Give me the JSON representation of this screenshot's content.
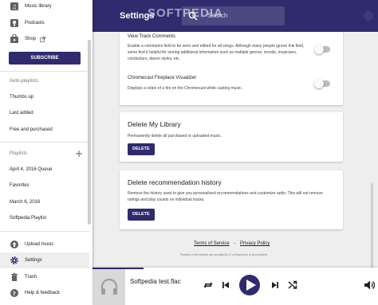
{
  "topbar": {
    "title": "Settings",
    "search_placeholder": "Search",
    "watermark": "SOFTPEDIA"
  },
  "sidebar": {
    "items_top": [
      {
        "label": "Music library",
        "icon": "music-library-icon"
      },
      {
        "label": "Podcasts",
        "icon": "podcast-icon"
      },
      {
        "label": "Shop",
        "icon": "shop-icon"
      }
    ],
    "subscribe_label": "SUBSCRIBE",
    "auto_playlists_header": "Auto-playlists",
    "auto_playlists": [
      "Thumbs up",
      "Last added",
      "Free and purchased"
    ],
    "playlists_header": "Playlists",
    "playlists": [
      "April 4, 2016 Queue",
      "Favorites",
      "March 6, 2016",
      "Softpedia Playlist"
    ],
    "items_bottom": [
      {
        "label": "Upload music",
        "icon": "upload-icon"
      },
      {
        "label": "Settings",
        "icon": "gear-icon"
      },
      {
        "label": "Trash",
        "icon": "trash-icon"
      },
      {
        "label": "Help & feedback",
        "icon": "help-icon"
      }
    ]
  },
  "settings": {
    "track_comments": {
      "title": "View Track Comments",
      "description": "Enable a comments field to be seen and edited for all songs. Although many people ignore this field, some find it helpful for storing additional information such as multiple genres, moods, musicians, conductors, dance styles, etc."
    },
    "fireplace": {
      "title": "Chromecast Fireplace Visualizer",
      "description": "Displays a video of a fire on the Chromecast while casting music."
    },
    "delete_library": {
      "title": "Delete My Library",
      "description": "Permanently delete all purchased or uploaded music.",
      "button": "DELETE"
    },
    "delete_history": {
      "title": "Delete recommendation history",
      "description": "Remove the history used to give you personalized recommendations and customize radio. This will not remove ratings and play counts on individual tracks.",
      "button": "DELETE"
    }
  },
  "footer": {
    "terms": "Terms of Service",
    "separator": "-",
    "privacy": "Privacy Policy",
    "note": "Portions of the content are provided by © of Gracenote or its providers."
  },
  "player": {
    "track_title": "Softpedia test.flac"
  },
  "colors": {
    "accent": "#2f2b6e"
  }
}
